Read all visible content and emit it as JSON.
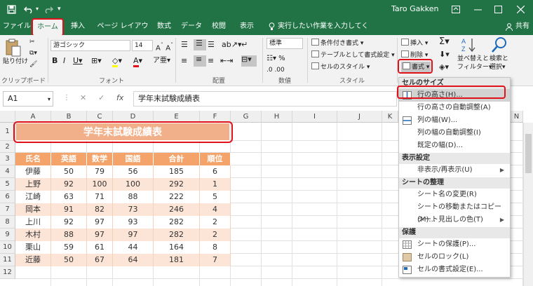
{
  "titlebar": {
    "user": "Taro Gakken",
    "quick_access": [
      "save-icon",
      "undo-icon",
      "redo-icon",
      "customize-icon"
    ]
  },
  "menu": {
    "tabs": [
      "ファイル",
      "ホーム",
      "挿入",
      "ページ レイアウト",
      "数式",
      "データ",
      "校閲",
      "表示"
    ],
    "tell_me": "実行したい作業を入力してください",
    "share": "共有"
  },
  "ribbon": {
    "clipboard": {
      "paste": "貼り付け",
      "label": "クリップボード"
    },
    "font": {
      "name": "游ゴシック",
      "size": "14",
      "label": "フォント"
    },
    "alignment": {
      "label": "配置"
    },
    "number": {
      "format": "標準",
      "label": "数値"
    },
    "styles": {
      "conditional": "条件付き書式",
      "table": "テーブルとして書式設定",
      "cell_style": "セルのスタイル",
      "label": "スタイル"
    },
    "cells": {
      "insert": "挿入",
      "delete": "削除",
      "format": "書式"
    },
    "editing": {
      "sort": "並べ替えと",
      "sort2": "フィルター",
      "find": "検索と",
      "find2": "選択"
    }
  },
  "formula_bar": {
    "name_box": "A1",
    "fx": "fx",
    "content": "学年末試験成績表"
  },
  "sheet": {
    "columns": [
      "A",
      "B",
      "C",
      "D",
      "E",
      "F",
      "G",
      "H",
      "I",
      "J",
      "K",
      "N"
    ],
    "rows": [
      "1",
      "2",
      "3",
      "4",
      "5",
      "6",
      "7",
      "8",
      "9",
      "10",
      "11",
      "12"
    ],
    "title": "学年末試験成績表",
    "headers": [
      "氏名",
      "英語",
      "数学",
      "国語",
      "合計",
      "順位"
    ],
    "records": [
      [
        "伊藤",
        "50",
        "79",
        "56",
        "185",
        "6"
      ],
      [
        "上野",
        "92",
        "100",
        "100",
        "292",
        "1"
      ],
      [
        "江崎",
        "63",
        "71",
        "88",
        "222",
        "5"
      ],
      [
        "岡本",
        "91",
        "82",
        "73",
        "246",
        "4"
      ],
      [
        "上川",
        "92",
        "97",
        "93",
        "282",
        "2"
      ],
      [
        "木村",
        "88",
        "97",
        "97",
        "282",
        "2"
      ],
      [
        "栗山",
        "59",
        "61",
        "44",
        "164",
        "8"
      ],
      [
        "近藤",
        "50",
        "67",
        "64",
        "181",
        "7"
      ]
    ]
  },
  "dropdown": {
    "sec_size": "セルのサイズ",
    "row_height": "行の高さ(H)...",
    "row_autofit": "行の高さの自動調整(A)",
    "col_width": "列の幅(W)...",
    "col_autofit": "列の幅の自動調整(I)",
    "default_width": "既定の幅(D)...",
    "sec_visibility": "表示設定",
    "hide_unhide": "非表示/再表示(U)",
    "sec_organize": "シートの整理",
    "rename": "シート名の変更(R)",
    "move_copy": "シートの移動またはコピー(M)...",
    "tab_color": "シート見出しの色(T)",
    "sec_protect": "保護",
    "protect_sheet": "シートの保護(P)...",
    "lock_cell": "セルのロック(L)",
    "format_cells": "セルの書式設定(E)..."
  },
  "colors": {
    "excel_green": "#217346",
    "header_orange": "#f4a46b",
    "title_fill": "#f2b08a",
    "row_light": "#fce4d6",
    "highlight_red": "#e0111b"
  }
}
